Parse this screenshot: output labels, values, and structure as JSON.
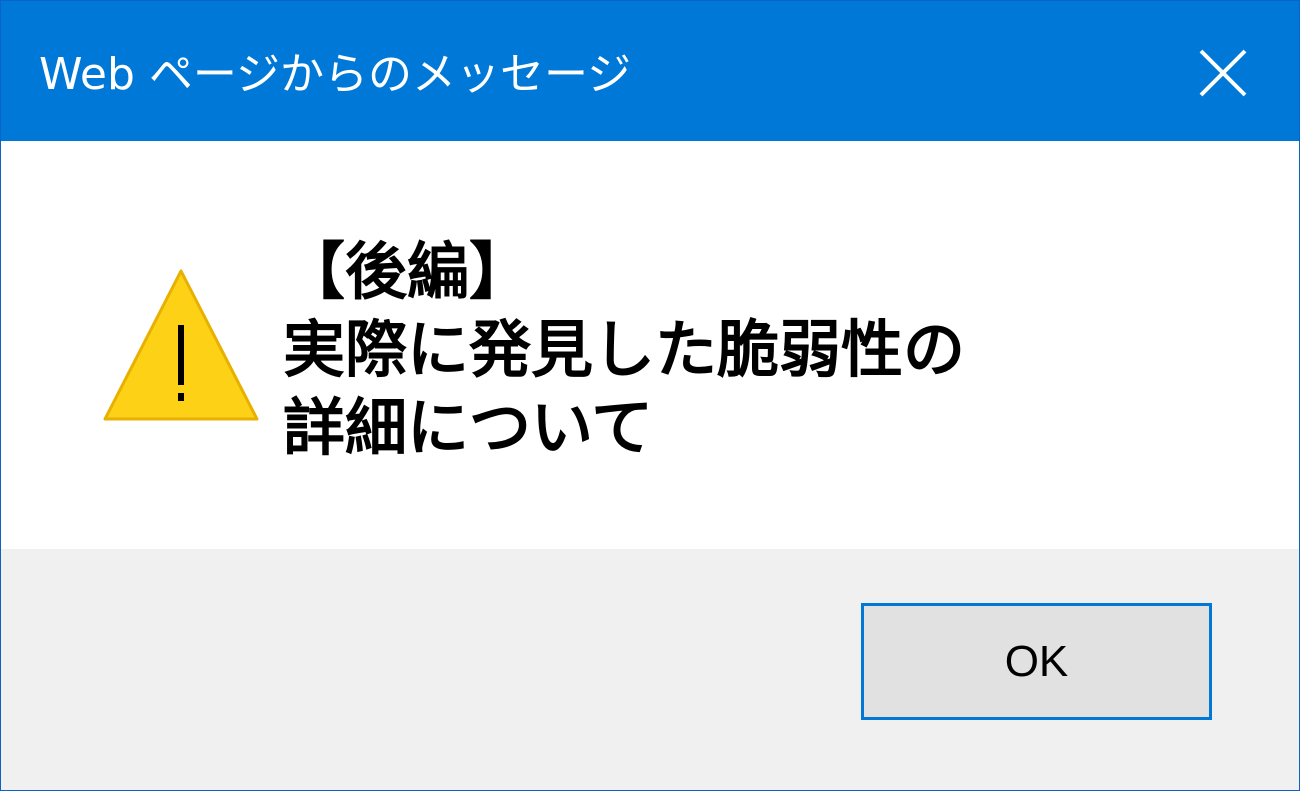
{
  "dialog": {
    "title": "Web ページからのメッセージ",
    "message": "【後編】\n実際に発見した脆弱性の\n詳細について",
    "ok_label": "OK",
    "icons": {
      "close": "close-icon",
      "warning": "warning-icon"
    }
  },
  "colors": {
    "titlebar": "#0078d7",
    "footer": "#f0f0f0",
    "button_face": "#e1e1e1",
    "button_border": "#0078d7",
    "warning_fill": "#fcd116",
    "warning_stroke": "#e8b000"
  }
}
